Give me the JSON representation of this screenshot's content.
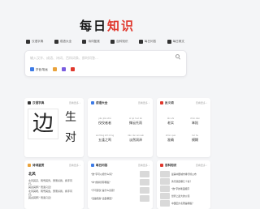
{
  "logo": {
    "chars": [
      "每",
      "日",
      "知",
      "识"
    ]
  },
  "nav": [
    {
      "label": "汉语字典",
      "icon": "dictionary-icon",
      "color": "#333333"
    },
    {
      "label": "成语大全",
      "icon": "idiom-icon",
      "color": "#333333"
    },
    {
      "label": "诗词鉴赏",
      "icon": "poem-icon",
      "color": "#333333"
    },
    {
      "label": "百科知识",
      "icon": "encyclopedia-icon",
      "color": "#333333"
    },
    {
      "label": "每日问答",
      "icon": "qa-icon",
      "color": "#333333"
    },
    {
      "label": "每日美文",
      "icon": "article-icon",
      "color": "#333333"
    }
  ],
  "search": {
    "placeholder": "输入汉字、成语、诗词、百科词条、即时问答…",
    "tools": [
      {
        "label": "拼音/笔画",
        "color": "#3d7be6"
      },
      {
        "label": "",
        "color": "#e9a23b"
      },
      {
        "label": "",
        "color": "#7a5ce0"
      },
      {
        "label": "",
        "color": "#e0382d"
      }
    ]
  },
  "cards": {
    "dictionary": {
      "title": "汉语字典",
      "more": "查看更多 ›",
      "big": "边",
      "small": [
        "生",
        "对"
      ]
    },
    "idioms": {
      "title": "成语大全",
      "more": "查看更多 ›",
      "items": [
        {
          "py": "jiǎo jiǎo zhě",
          "word": "佼佼者者"
        },
        {
          "py": "sǐ qù huó lái",
          "word": "撑云托雨"
        },
        {
          "py": "wǔ fēng zhī míng",
          "word": "五逢之鸣"
        },
        {
          "py": "dàn rán wú wèi",
          "word": "淡然润泽"
        }
      ]
    },
    "antonyms": {
      "title": "反义词",
      "more": "查看更多 ›",
      "items": [
        {
          "py": "lǎo shí",
          "word": "老实"
        },
        {
          "py": "chǔn bèn",
          "word": "笨拙"
        },
        {
          "py": "zhǔn què",
          "word": "准确"
        },
        {
          "py": "mó hu",
          "word": "模糊"
        }
      ]
    },
    "poem": {
      "title": "诗词鉴赏",
      "more": "查看更多 ›",
      "name": "北风",
      "lines": [
        "北风其凉，雨雪其雱。惠而好我，携手同行。",
        "其虚其邪？既亟只且！",
        "北风其喈，雨雪其霏。惠而好我，携手同归。",
        "其虚其邪？既亟只且！"
      ]
    },
    "qa": {
      "title": "每日问答",
      "more": "查看更多 ›",
      "items": [
        "\"欲\"字可以组什么词？",
        "\"中\"的拼音有哪些？",
        "\"不可思议\"是什么意思？",
        "\"温故知新\"出自哪里？"
      ]
    },
    "encyclopedia": {
      "title": "百科知识",
      "more": "查看更多 ›",
      "items": [
        "最美中国城市排行榜公布",
        "黄河流经哪几个省？",
        "\"欲\"字的笔画顺序",
        "世界上最大的沙漠",
        "中国四大名著是哪些？"
      ]
    }
  },
  "colors": {
    "accent": "#e0382d",
    "blue": "#3d7be6"
  }
}
